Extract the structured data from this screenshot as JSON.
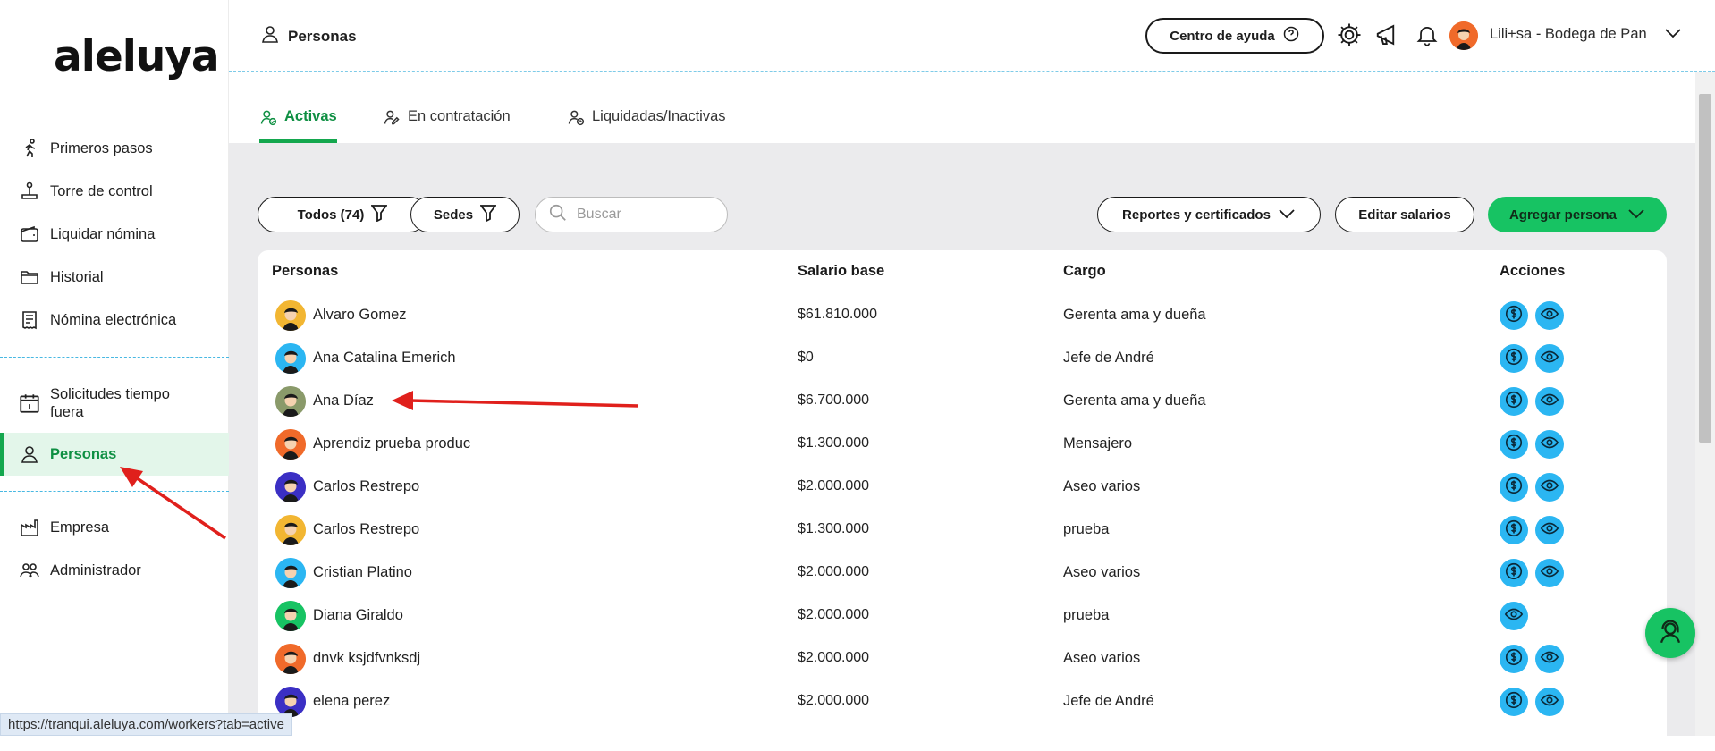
{
  "app": {
    "logo_text": "aleluya"
  },
  "sidebar": {
    "items": [
      {
        "label": "Primeros pasos",
        "icon": "runner-icon"
      },
      {
        "label": "Torre de control",
        "icon": "joystick-icon"
      },
      {
        "label": "Liquidar nómina",
        "icon": "wallet-icon"
      },
      {
        "label": "Historial",
        "icon": "folder-icon"
      },
      {
        "label": "Nómina electrónica",
        "icon": "receipt-icon"
      },
      {
        "label": "Solicitudes tiempo fuera",
        "icon": "calendar-icon"
      },
      {
        "label": "Personas",
        "icon": "person-icon",
        "active": true
      },
      {
        "label": "Empresa",
        "icon": "factory-icon"
      },
      {
        "label": "Administrador",
        "icon": "people-icon"
      }
    ]
  },
  "header": {
    "title": "Personas",
    "help_label": "Centro de ayuda",
    "user_name": "Lili+sa - Bodega de Pan"
  },
  "tabs": [
    {
      "label": "Activas",
      "active": true
    },
    {
      "label": "En contratación"
    },
    {
      "label": "Liquidadas/Inactivas"
    }
  ],
  "toolbar": {
    "filter_all": "Todos (74)",
    "filter_sedes": "Sedes",
    "search_placeholder": "Buscar",
    "reports_label": "Reportes y certificados",
    "edit_salaries_label": "Editar salarios",
    "add_person_label": "Agregar persona"
  },
  "table": {
    "headers": {
      "persons": "Personas",
      "salary": "Salario base",
      "role": "Cargo",
      "actions": "Acciones"
    },
    "rows": [
      {
        "name": "Alvaro Gomez",
        "salary": "$61.810.000",
        "role": "Gerenta ama y dueña",
        "avatar_color": "#f2b632",
        "actions": [
          "salary",
          "view"
        ]
      },
      {
        "name": "Ana Catalina Emerich",
        "salary": "$0",
        "role": "Jefe de André",
        "avatar_color": "#2bb6f2",
        "actions": [
          "salary",
          "view"
        ]
      },
      {
        "name": "Ana  Díaz",
        "salary": "$6.700.000",
        "role": "Gerenta ama y dueña",
        "avatar_color": "#8a9a6a",
        "actions": [
          "salary",
          "view"
        ]
      },
      {
        "name": "Aprendiz prueba produc",
        "salary": "$1.300.000",
        "role": "Mensajero",
        "avatar_color": "#f06a2a",
        "actions": [
          "salary",
          "view"
        ]
      },
      {
        "name": "Carlos Restrepo",
        "salary": "$2.000.000",
        "role": "Aseo varios",
        "avatar_color": "#3b2fc4",
        "actions": [
          "salary",
          "view"
        ]
      },
      {
        "name": "Carlos Restrepo",
        "salary": "$1.300.000",
        "role": "prueba",
        "avatar_color": "#f2b632",
        "actions": [
          "salary",
          "view"
        ]
      },
      {
        "name": "Cristian Platino",
        "salary": "$2.000.000",
        "role": "Aseo varios",
        "avatar_color": "#2bb6f2",
        "actions": [
          "salary",
          "view"
        ]
      },
      {
        "name": "Diana Giraldo",
        "salary": "$2.000.000",
        "role": "prueba",
        "avatar_color": "#17c363",
        "actions": [
          "view"
        ]
      },
      {
        "name": "dnvk ksjdfvnksdj",
        "salary": "$2.000.000",
        "role": "Aseo varios",
        "avatar_color": "#f06a2a",
        "actions": [
          "salary",
          "view"
        ]
      },
      {
        "name": "elena perez",
        "salary": "$2.000.000",
        "role": "Jefe de André",
        "avatar_color": "#3b2fc4",
        "actions": [
          "salary",
          "view"
        ]
      }
    ]
  },
  "status_bar": {
    "url": "https://tranqui.aleluya.com/workers?tab=active"
  },
  "colors": {
    "brand_green": "#17c363",
    "active_green_text": "#0e8f42",
    "action_blue": "#2bb6f2",
    "annotation_red": "#e0201c"
  }
}
